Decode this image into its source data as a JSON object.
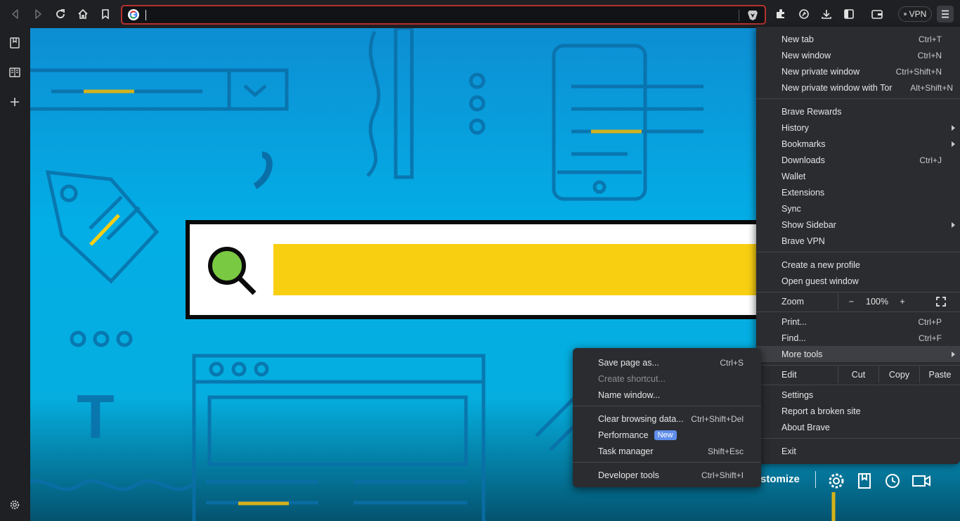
{
  "toolbar": {
    "vpn_label": "VPN",
    "address_value": ""
  },
  "content": {
    "customize_label": "stomize"
  },
  "menu": {
    "items": [
      {
        "label": "New tab",
        "shortcut": "Ctrl+T"
      },
      {
        "label": "New window",
        "shortcut": "Ctrl+N"
      },
      {
        "label": "New private window",
        "shortcut": "Ctrl+Shift+N"
      },
      {
        "label": "New private window with Tor",
        "shortcut": "Alt+Shift+N"
      },
      {
        "label": "Brave Rewards",
        "shortcut": ""
      },
      {
        "label": "History",
        "shortcut": ""
      },
      {
        "label": "Bookmarks",
        "shortcut": ""
      },
      {
        "label": "Downloads",
        "shortcut": "Ctrl+J"
      },
      {
        "label": "Wallet",
        "shortcut": ""
      },
      {
        "label": "Extensions",
        "shortcut": ""
      },
      {
        "label": "Sync",
        "shortcut": ""
      },
      {
        "label": "Show Sidebar",
        "shortcut": ""
      },
      {
        "label": "Brave VPN",
        "shortcut": ""
      },
      {
        "label": "Create a new profile",
        "shortcut": ""
      },
      {
        "label": "Open guest window",
        "shortcut": ""
      },
      {
        "label": "Print...",
        "shortcut": "Ctrl+P"
      },
      {
        "label": "Find...",
        "shortcut": "Ctrl+F"
      },
      {
        "label": "More tools",
        "shortcut": ""
      },
      {
        "label": "Settings",
        "shortcut": ""
      },
      {
        "label": "Report a broken site",
        "shortcut": ""
      },
      {
        "label": "About Brave",
        "shortcut": ""
      },
      {
        "label": "Exit",
        "shortcut": ""
      }
    ],
    "zoom": {
      "label": "Zoom",
      "minus": "−",
      "value": "100%",
      "plus": "+"
    },
    "edit": {
      "label": "Edit",
      "cut": "Cut",
      "copy": "Copy",
      "paste": "Paste"
    }
  },
  "submenu": {
    "items": [
      {
        "label": "Save page as...",
        "shortcut": "Ctrl+S"
      },
      {
        "label": "Create shortcut...",
        "shortcut": ""
      },
      {
        "label": "Name window...",
        "shortcut": ""
      },
      {
        "label": "Clear browsing data...",
        "shortcut": "Ctrl+Shift+Del"
      },
      {
        "label": "Performance",
        "shortcut": ""
      },
      {
        "label": "Task manager",
        "shortcut": "Shift+Esc"
      },
      {
        "label": "Developer tools",
        "shortcut": "Ctrl+Shift+I"
      }
    ],
    "badge_new": "New"
  }
}
